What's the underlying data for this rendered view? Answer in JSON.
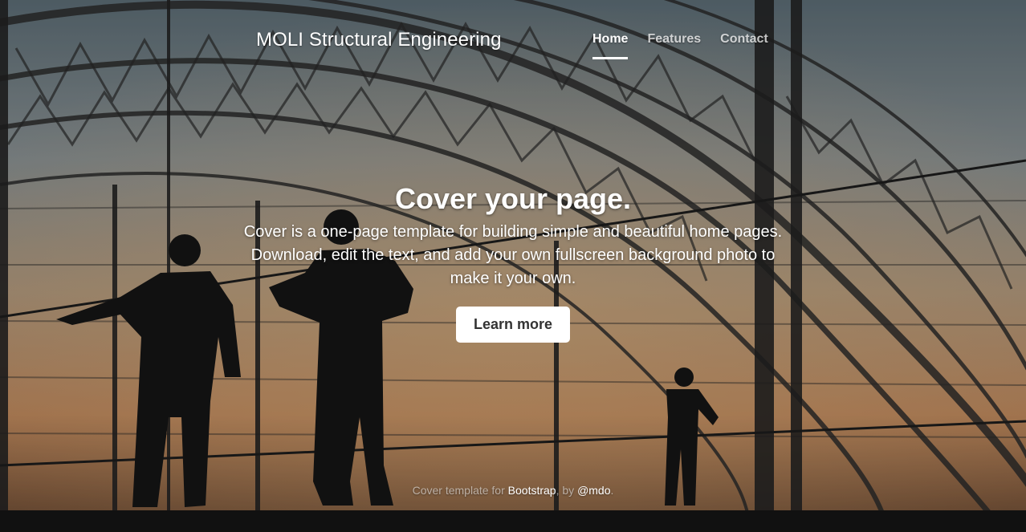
{
  "header": {
    "brand": "MOLI Structural Engineering",
    "nav": [
      {
        "label": "Home",
        "active": true
      },
      {
        "label": "Features",
        "active": false
      },
      {
        "label": "Contact",
        "active": false
      }
    ]
  },
  "hero": {
    "title": "Cover your page.",
    "lead": "Cover is a one-page template for building simple and beautiful home pages. Download, edit the text, and add your own fullscreen background photo to make it your own.",
    "button_label": "Learn more"
  },
  "footer": {
    "prefix": "Cover template for ",
    "link1": "Bootstrap",
    "middle": ", by ",
    "link2": "@mdo",
    "suffix": "."
  },
  "colors": {
    "text": "#ffffff",
    "button_bg": "#ffffff",
    "button_text": "#333333"
  }
}
